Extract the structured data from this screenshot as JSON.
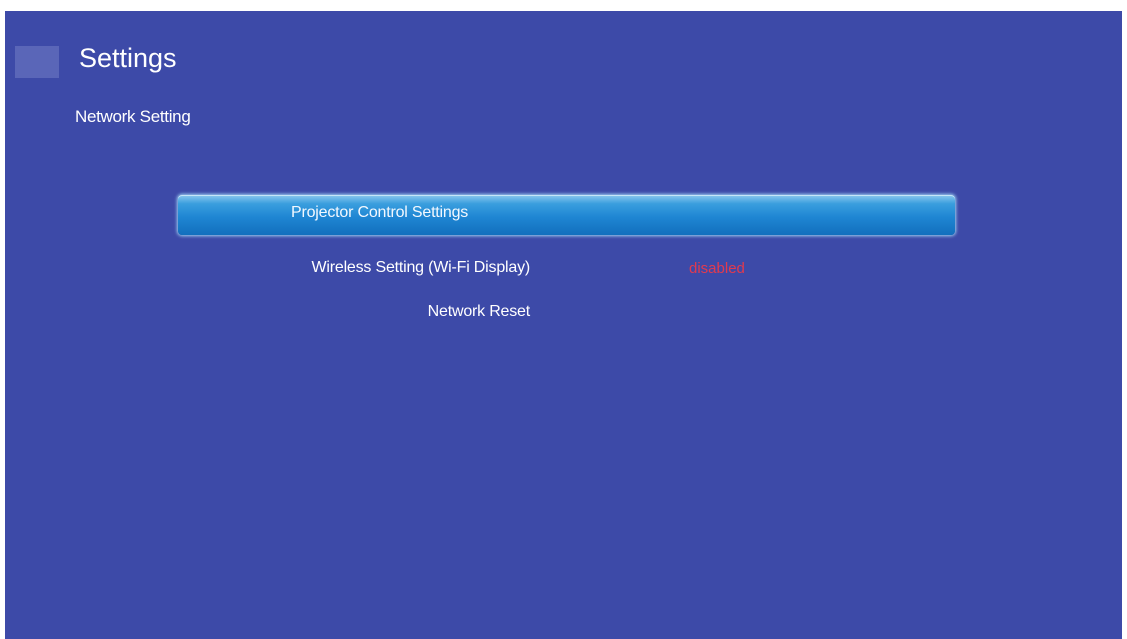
{
  "header": {
    "title": "Settings",
    "subtitle": "Network Setting"
  },
  "menu": {
    "items": [
      {
        "label": "Projector Control Settings",
        "value": "",
        "selected": true
      },
      {
        "label": "Wireless Setting (Wi-Fi Display)",
        "value": "disabled",
        "selected": false
      },
      {
        "label": "Network Reset",
        "value": "",
        "selected": false
      }
    ]
  },
  "colors": {
    "background": "#3d4aa8",
    "selection": "#1f86d3",
    "status_disabled": "#e23a4e",
    "text": "#ffffff"
  },
  "icons": {
    "app": "settings-app-icon"
  }
}
